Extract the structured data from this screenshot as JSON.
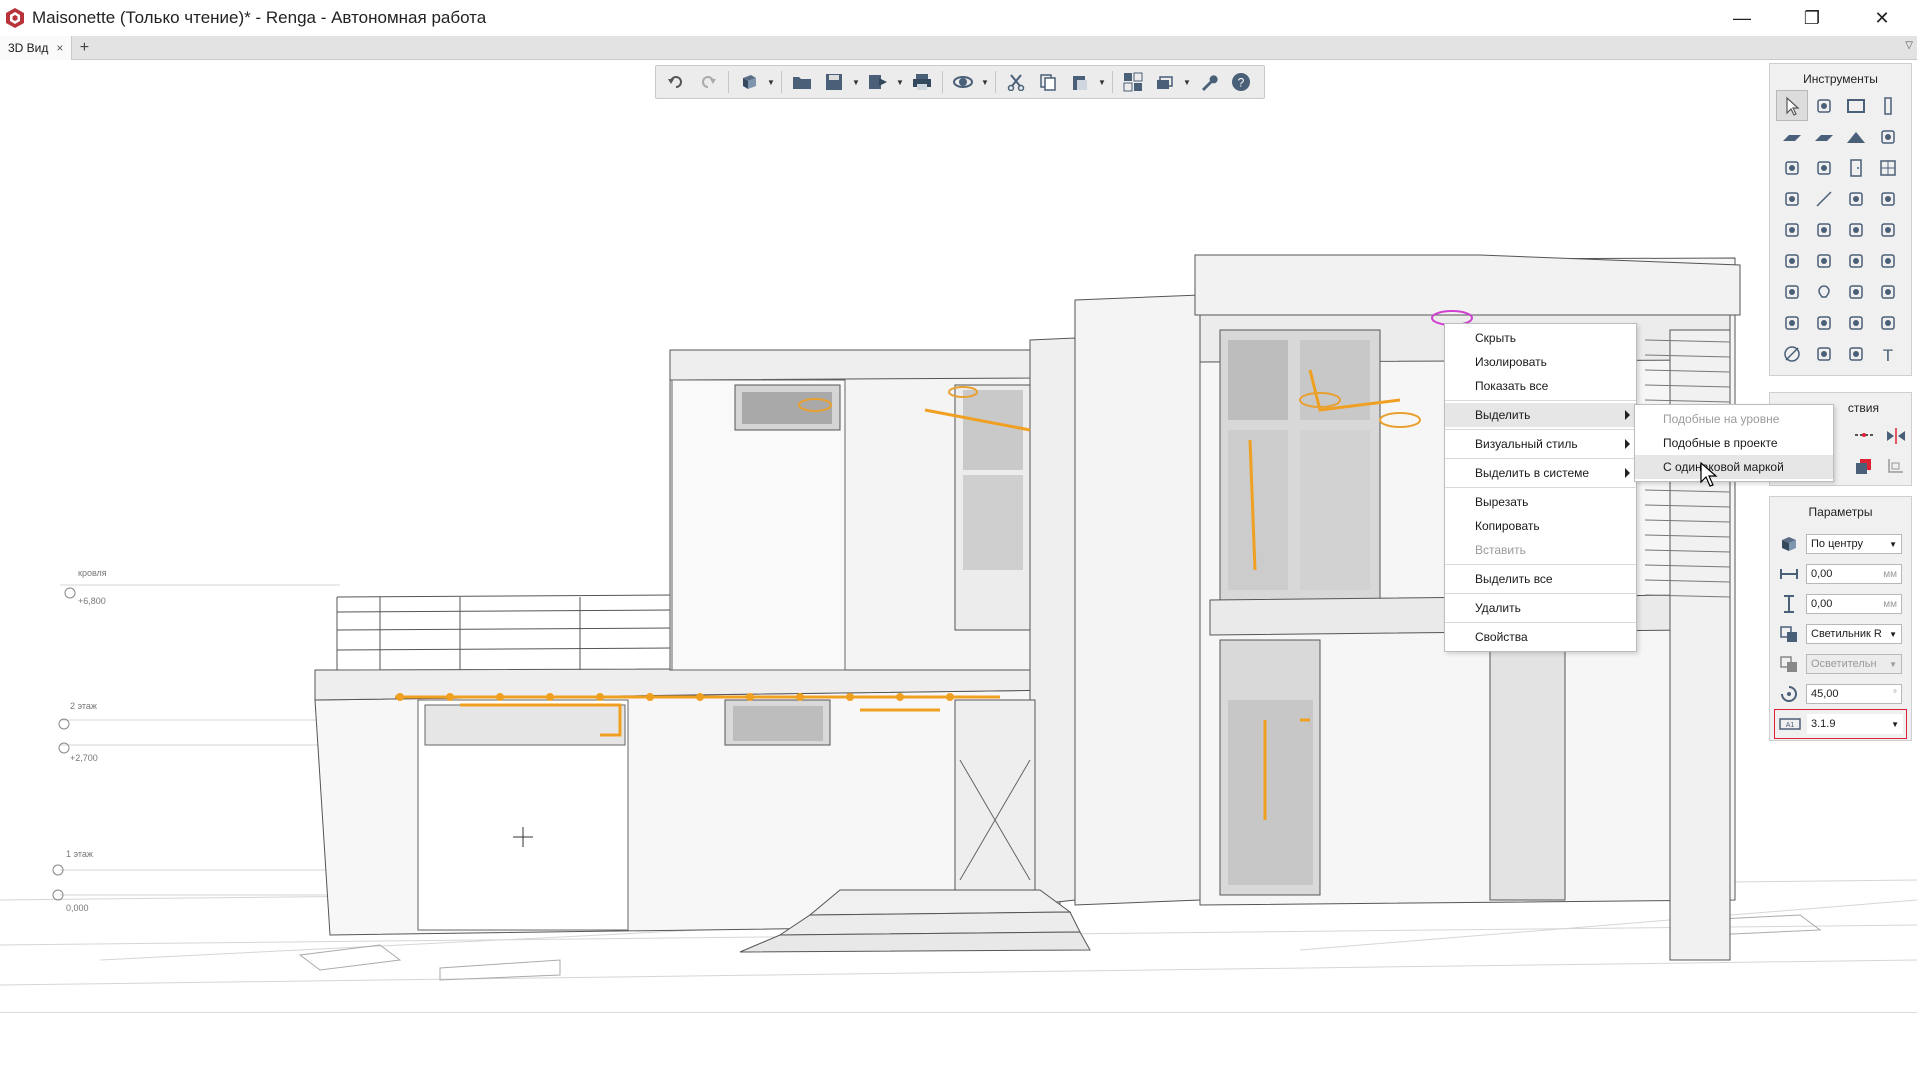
{
  "window": {
    "title": "Maisonette (Только чтение)* - Renga - Автономная работа",
    "minimize_glyph": "—",
    "maximize_glyph": "❐",
    "close_glyph": "✕"
  },
  "tabs": [
    {
      "label": "3D Вид",
      "close": "×"
    }
  ],
  "tab_add": "+",
  "tab_dropdown": "▽",
  "toolbar": {
    "icons": [
      "undo-icon",
      "redo-icon",
      "3d-view-icon",
      "open-folder-icon",
      "save-icon",
      "export-icon",
      "print-icon",
      "orbit-icon",
      "cut-icon",
      "copy-icon",
      "paste-icon",
      "grid-view-icon",
      "layers-icon",
      "settings-wrench-icon",
      "help-icon"
    ]
  },
  "tools_panel": {
    "title": "Инструменты",
    "tools": [
      "select-cursor-icon",
      "level-icon",
      "room-icon",
      "column-icon",
      "wall-icon",
      "slab-icon",
      "roof-icon",
      "beam-icon",
      "stair-icon",
      "ramp-icon",
      "door-icon",
      "window-icon",
      "railing-icon",
      "line-icon",
      "plumbing-icon",
      "duct-icon",
      "equipment-icon",
      "boiler-icon",
      "valve-icon",
      "fitting-icon",
      "pipe-accessory-icon",
      "pump-icon",
      "radiator-icon",
      "duct-fitting-icon",
      "mechanical-icon",
      "light-fixture-icon",
      "switch-icon",
      "socket-icon",
      "panel-icon",
      "junction-icon",
      "cable-tray-icon",
      "conduit-icon",
      "dimension-icon",
      "elevation-mark-icon",
      "hatch-icon",
      "text-icon"
    ],
    "text_tool_glyph": "T"
  },
  "actions_panel": {
    "title": "ствия"
  },
  "params_panel": {
    "title": "Параметры",
    "rows": [
      {
        "icon": "placement-icon",
        "value": "По центру",
        "unit": "",
        "dropdown": true
      },
      {
        "icon": "offset-horizontal-icon",
        "value": "0,00",
        "unit": "мм",
        "dropdown": false
      },
      {
        "icon": "offset-vertical-icon",
        "value": "0,00",
        "unit": "мм",
        "dropdown": false
      },
      {
        "icon": "style-icon",
        "value": "Светильник R",
        "unit": "",
        "dropdown": true
      },
      {
        "icon": "system-icon",
        "value": "Осветительн",
        "unit": "",
        "dropdown": true
      },
      {
        "icon": "rotation-icon",
        "value": "45,00",
        "unit": "°",
        "dropdown": false
      },
      {
        "icon": "mark-icon",
        "value": "3.1.9",
        "unit": "",
        "dropdown": true
      }
    ]
  },
  "context_menu": {
    "items": [
      {
        "label": "Скрыть",
        "state": "normal"
      },
      {
        "label": "Изолировать",
        "state": "normal"
      },
      {
        "label": "Показать все",
        "state": "normal"
      },
      {
        "sep": true
      },
      {
        "label": "Выделить",
        "state": "highlight",
        "submenu": true
      },
      {
        "sep": true
      },
      {
        "label": "Визуальный стиль",
        "state": "normal",
        "submenu": true
      },
      {
        "sep": true
      },
      {
        "label": "Выделить в системе",
        "state": "normal",
        "submenu": true
      },
      {
        "sep": true
      },
      {
        "label": "Вырезать",
        "state": "normal"
      },
      {
        "label": "Копировать",
        "state": "normal"
      },
      {
        "label": "Вставить",
        "state": "disabled"
      },
      {
        "sep": true
      },
      {
        "label": "Выделить все",
        "state": "normal"
      },
      {
        "sep": true
      },
      {
        "label": "Удалить",
        "state": "normal"
      },
      {
        "sep": true
      },
      {
        "label": "Свойства",
        "state": "normal"
      }
    ]
  },
  "submenu": {
    "items": [
      {
        "label": "Подобные на уровне",
        "state": "disabled"
      },
      {
        "label": "Подобные в проекте",
        "state": "normal"
      },
      {
        "label": "С одинаковой маркой",
        "state": "highlight"
      }
    ]
  },
  "level_markers": [
    {
      "name": "кровля",
      "value": "+6,800"
    },
    {
      "name": "2 этаж",
      "value": "+2,700"
    },
    {
      "name": "1 этаж",
      "value": "0,000"
    }
  ],
  "colors": {
    "accent_orange": "#f0a020",
    "selection_magenta": "#d040d0",
    "panel_bg": "#f0f0f0",
    "toolbar_bg": "#ececec"
  }
}
